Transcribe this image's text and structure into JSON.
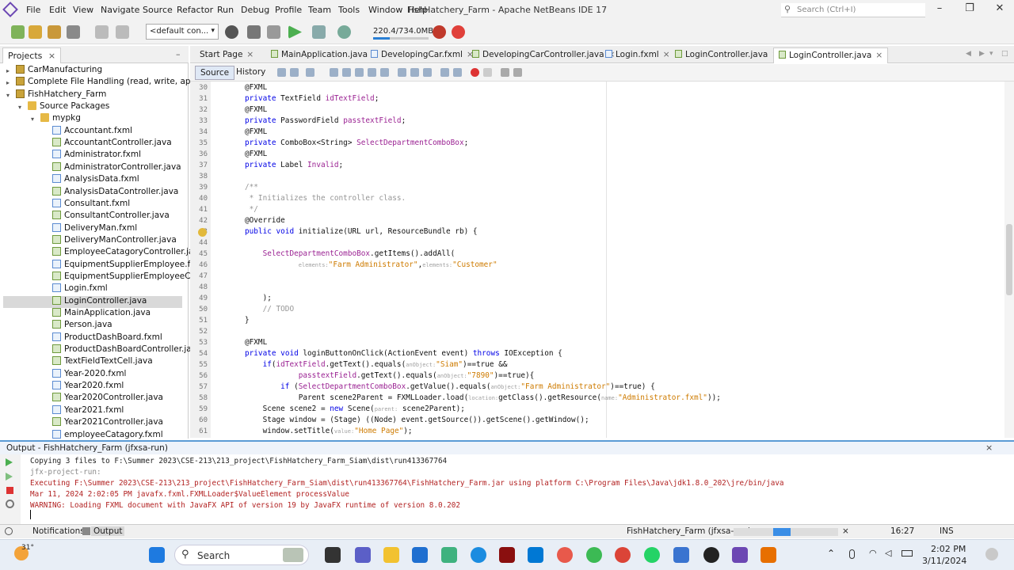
{
  "window": {
    "title": "FishHatchery_Farm - Apache NetBeans IDE 17",
    "search_placeholder": "Search (Ctrl+I)",
    "menu": [
      "File",
      "Edit",
      "View",
      "Navigate",
      "Source",
      "Refactor",
      "Run",
      "Debug",
      "Profile",
      "Team",
      "Tools",
      "Window",
      "Help"
    ]
  },
  "toolbar": {
    "config": "<default con...",
    "memory": "220.4/734.0MB",
    "memory_fraction": 0.3
  },
  "projects": {
    "tab_label": "Projects",
    "close": "×",
    "tree": [
      {
        "label": "CarManufacturing",
        "level": 0,
        "type": "proj",
        "toggle": "▸"
      },
      {
        "label": "Complete File Handling (read, write, append",
        "level": 0,
        "type": "proj",
        "toggle": "▸"
      },
      {
        "label": "FishHatchery_Farm",
        "level": 0,
        "type": "proj",
        "toggle": "▾"
      },
      {
        "label": "Source Packages",
        "level": 1,
        "type": "folder",
        "toggle": "▾"
      },
      {
        "label": "mypkg",
        "level": 2,
        "type": "folder",
        "toggle": "▾"
      },
      {
        "label": "Accountant.fxml",
        "level": 3,
        "type": "file"
      },
      {
        "label": "AccountantController.java",
        "level": 3,
        "type": "java"
      },
      {
        "label": "Administrator.fxml",
        "level": 3,
        "type": "file"
      },
      {
        "label": "AdministratorController.java",
        "level": 3,
        "type": "java"
      },
      {
        "label": "AnalysisData.fxml",
        "level": 3,
        "type": "file"
      },
      {
        "label": "AnalysisDataController.java",
        "level": 3,
        "type": "java"
      },
      {
        "label": "Consultant.fxml",
        "level": 3,
        "type": "file"
      },
      {
        "label": "ConsultantController.java",
        "level": 3,
        "type": "java"
      },
      {
        "label": "DeliveryMan.fxml",
        "level": 3,
        "type": "file"
      },
      {
        "label": "DeliveryManController.java",
        "level": 3,
        "type": "java"
      },
      {
        "label": "EmployeeCatagoryController.java",
        "level": 3,
        "type": "java"
      },
      {
        "label": "EquipmentSupplierEmployee.fxml",
        "level": 3,
        "type": "file"
      },
      {
        "label": "EquipmentSupplierEmployeeCont",
        "level": 3,
        "type": "java"
      },
      {
        "label": "Login.fxml",
        "level": 3,
        "type": "file"
      },
      {
        "label": "LoginController.java",
        "level": 3,
        "type": "java",
        "selected": true
      },
      {
        "label": "MainApplication.java",
        "level": 3,
        "type": "java"
      },
      {
        "label": "Person.java",
        "level": 3,
        "type": "java"
      },
      {
        "label": "ProductDashBoard.fxml",
        "level": 3,
        "type": "file"
      },
      {
        "label": "ProductDashBoardController.java",
        "level": 3,
        "type": "java"
      },
      {
        "label": "TextFieldTextCell.java",
        "level": 3,
        "type": "java"
      },
      {
        "label": "Year-2020.fxml",
        "level": 3,
        "type": "file"
      },
      {
        "label": "Year2020.fxml",
        "level": 3,
        "type": "file"
      },
      {
        "label": "Year2020Controller.java",
        "level": 3,
        "type": "java"
      },
      {
        "label": "Year2021.fxml",
        "level": 3,
        "type": "file"
      },
      {
        "label": "Year2021Controller.java",
        "level": 3,
        "type": "java"
      },
      {
        "label": "employeeCatagory.fxml",
        "level": 3,
        "type": "file"
      }
    ]
  },
  "editor": {
    "tabs": [
      {
        "label": "Start Page",
        "active": false
      },
      {
        "label": "MainApplication.java",
        "active": false
      },
      {
        "label": "DevelopingCar.fxml",
        "active": false
      },
      {
        "label": "DevelopingCarController.java",
        "active": false
      },
      {
        "label": "Login.fxml",
        "active": false
      },
      {
        "label": "LoginController.java",
        "active": false
      },
      {
        "label": "LoginController.java",
        "active": true
      }
    ],
    "tab_close": "×",
    "source_label": "Source",
    "history_label": "History",
    "lines": [
      {
        "n": "30",
        "text": "@FXML"
      },
      {
        "n": "31",
        "text": "private TextField idTextField;"
      },
      {
        "n": "32",
        "text": "@FXML"
      },
      {
        "n": "33",
        "text": "private PasswordField passtextField;"
      },
      {
        "n": "34",
        "text": "@FXML"
      },
      {
        "n": "35",
        "text": "private ComboBox<String> SelectDepartmentComboBox;"
      },
      {
        "n": "36",
        "text": "@FXML"
      },
      {
        "n": "37",
        "text": "private Label Invalid;"
      },
      {
        "n": "38",
        "text": ""
      },
      {
        "n": "39",
        "text": "/**"
      },
      {
        "n": "40",
        "text": " * Initializes the controller class."
      },
      {
        "n": "41",
        "text": " */"
      },
      {
        "n": "42",
        "text": "@Override"
      },
      {
        "n": "43",
        "text": "public void initialize(URL url, ResourceBundle rb) {"
      },
      {
        "n": "44",
        "text": ""
      },
      {
        "n": "45",
        "text": "    SelectDepartmentComboBox.getItems().addAll("
      },
      {
        "n": "46",
        "text": "            elements:\"Farm Administrator\",elements:\"Customer\""
      },
      {
        "n": "47",
        "text": ""
      },
      {
        "n": "48",
        "text": ""
      },
      {
        "n": "49",
        "text": "    );"
      },
      {
        "n": "50",
        "text": "    // TODO"
      },
      {
        "n": "51",
        "text": "}"
      },
      {
        "n": "52",
        "text": ""
      },
      {
        "n": "53",
        "text": "@FXML"
      },
      {
        "n": "54",
        "text": "private void loginButtonOnClick(ActionEvent event) throws IOException {"
      },
      {
        "n": "55",
        "text": "    if(idTextField.getText().equals(anObject:\"Siam\")==true &&"
      },
      {
        "n": "56",
        "text": "            passtextField.getText().equals(anObject:\"7890\")==true){"
      },
      {
        "n": "57",
        "text": "        if (SelectDepartmentComboBox.getValue().equals(anObject:\"Farm Administrator\")==true) {"
      },
      {
        "n": "58",
        "text": "            Parent scene2Parent = FXMLLoader.load(location:getClass().getResource(name:\"Administrator.fxml\"));"
      },
      {
        "n": "59",
        "text": "    Scene scene2 = new Scene(parent: scene2Parent);"
      },
      {
        "n": "60",
        "text": "    Stage window = (Stage) ((Node) event.getSource()).getScene().getWindow();"
      },
      {
        "n": "61",
        "text": "    window.setTitle(value:\"Home Page\");"
      }
    ]
  },
  "output": {
    "title": "Output - FishHatchery_Farm (jfxsa-run)",
    "close": "×",
    "lines": [
      {
        "text": "Copying 3 files to F:\\Summer 2023\\CSE-213\\213_project\\FishHatchery_Farm_Siam\\dist\\run413367764",
        "color": "#222222"
      },
      {
        "text": "jfx-project-run:",
        "color": "#8a8a8a"
      },
      {
        "text": "Executing F:\\Summer 2023\\CSE-213\\213_project\\FishHatchery_Farm_Siam\\dist\\run413367764\\FishHatchery_Farm.jar using platform C:\\Program Files\\Java\\jdk1.8.0_202\\jre/bin/java",
        "color": "#b22222"
      },
      {
        "text": "Mar 11, 2024 2:02:05 PM javafx.fxml.FXMLLoader$ValueElement processValue",
        "color": "#b22222"
      },
      {
        "text": "WARNING: Loading FXML document with JavaFX API of version 19 by JavaFX runtime of version 8.0.202",
        "color": "#b22222"
      }
    ]
  },
  "statusbar": {
    "notifications": "Notifications",
    "output": "Output",
    "task": "FishHatchery_Farm (jfxsa-run)",
    "close": "×",
    "position": "16:27",
    "mode": "INS"
  },
  "taskbar": {
    "weather": "31°",
    "search": "Search",
    "time": "2:02 PM",
    "date": "3/11/2024"
  },
  "colors": {
    "keyword": "#0000e6",
    "field": "#9b2393",
    "string": "#ce7b00",
    "comment": "#969696",
    "annotation": "#222222"
  }
}
